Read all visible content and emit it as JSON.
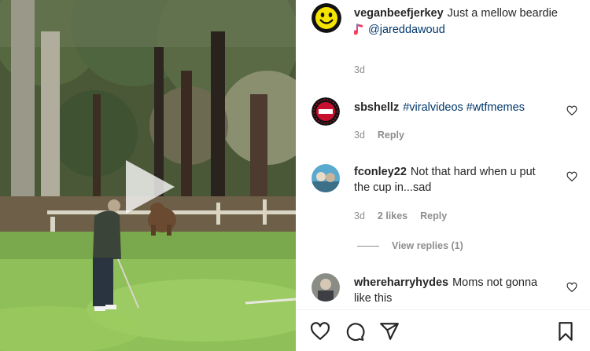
{
  "video": {
    "play_icon": "play-icon"
  },
  "caption": {
    "username": "veganbeefjerkey",
    "text": "Just a mellow beardie",
    "music_icon": "music-note-icon",
    "mention": "@jareddawoud",
    "time": "3d"
  },
  "comments": [
    {
      "username": "sbshellz",
      "text": "#viralvideos #wtfmemes",
      "time": "3d",
      "likes": "",
      "reply": "Reply"
    },
    {
      "username": "fconley22",
      "text": "Not that hard when u put the cup in...sad",
      "time": "3d",
      "likes": "2 likes",
      "reply": "Reply"
    },
    {
      "username": "whereharryhydes",
      "text": "Moms not gonna like this",
      "time": "",
      "likes": "",
      "reply": ""
    }
  ],
  "view_replies": "View replies (1)",
  "actions": [
    "heart-icon",
    "comment-icon",
    "share-icon",
    "bookmark-icon"
  ],
  "colors": {
    "hashtag": "#00376b",
    "meta": "#8e8e8e",
    "text": "#262626"
  }
}
